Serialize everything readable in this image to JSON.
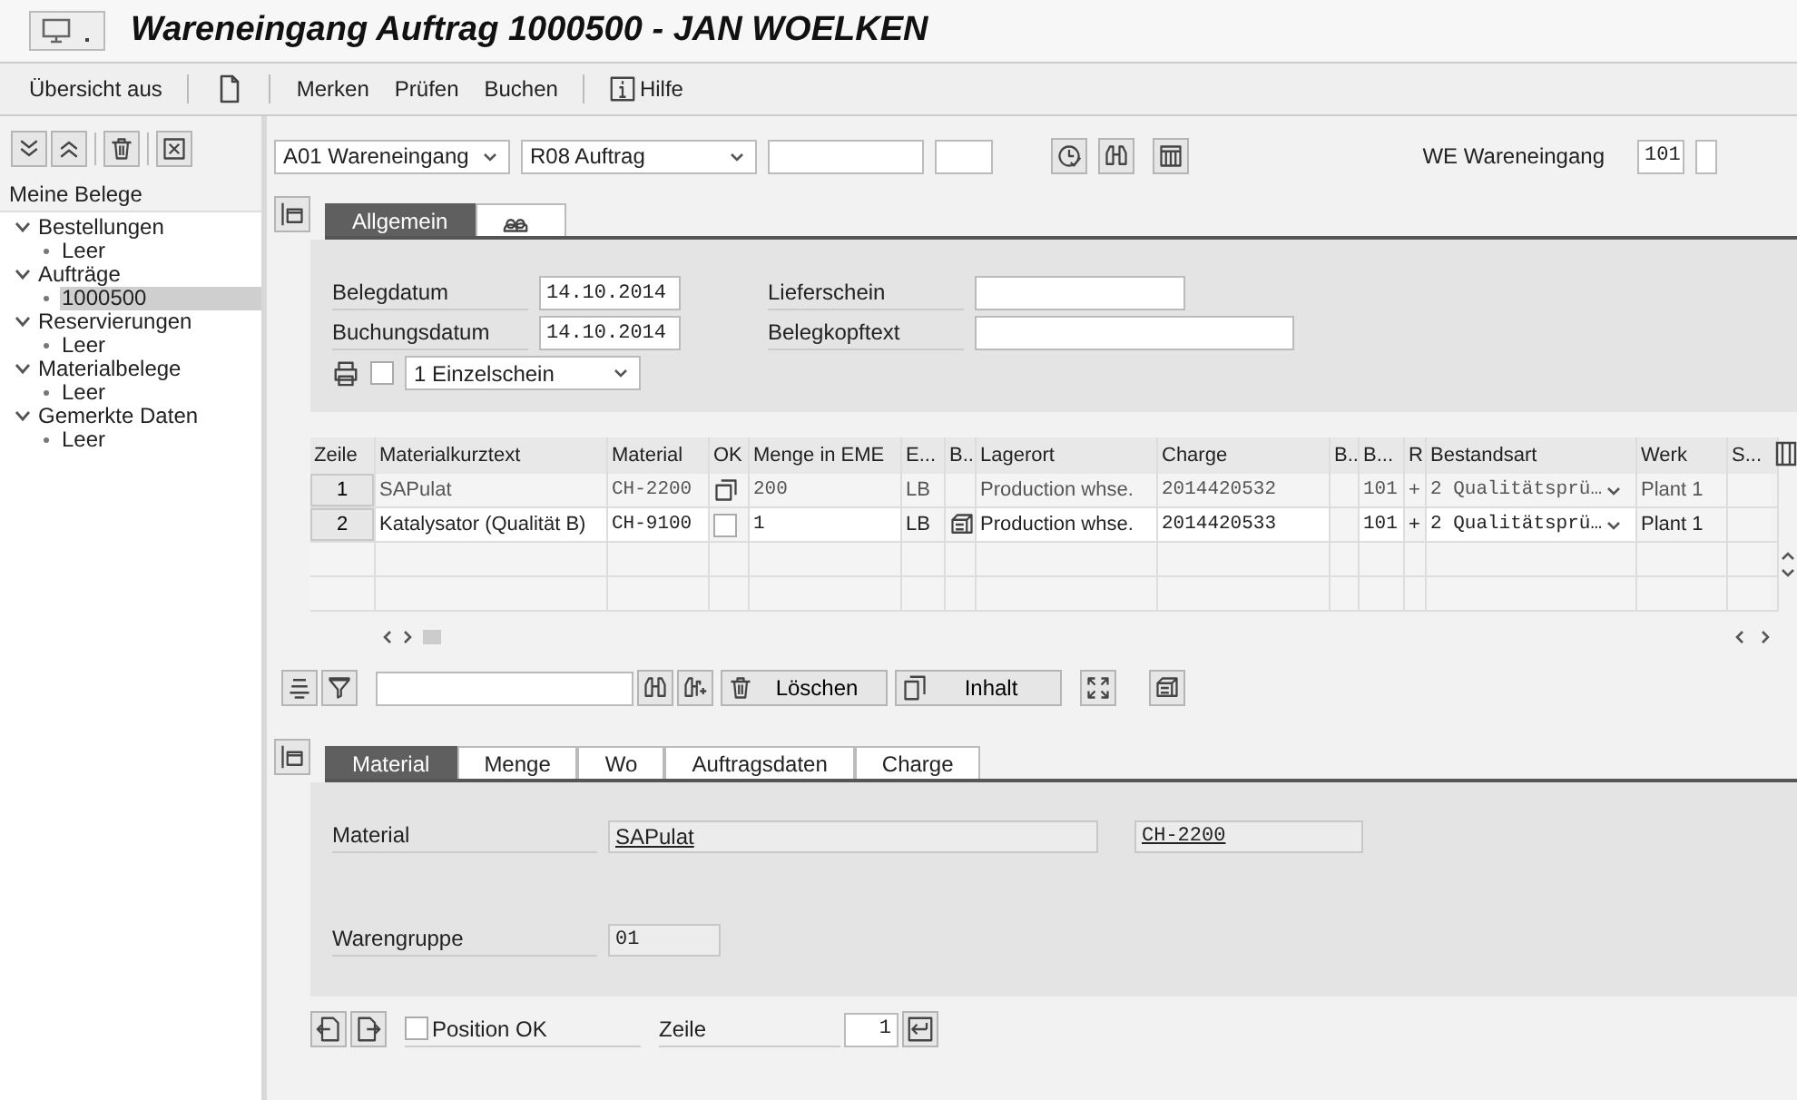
{
  "window": {
    "title": "Wareneingang Auftrag 1000500 - JAN WOELKEN"
  },
  "toolbar": {
    "groups": [
      [
        {
          "kind": "text",
          "label": "Übersicht aus"
        }
      ],
      [
        {
          "kind": "document"
        }
      ],
      [
        {
          "kind": "text",
          "label": "Merken"
        },
        {
          "kind": "text",
          "label": "Prüfen"
        },
        {
          "kind": "text",
          "label": "Buchen"
        }
      ],
      [
        {
          "kind": "help",
          "label": "Hilfe"
        }
      ]
    ]
  },
  "sidebar": {
    "title": "Meine Belege",
    "tree": [
      {
        "label": "Bestellungen",
        "expanded": true,
        "selected": false,
        "children": [
          {
            "label": "Leer",
            "selected": false
          }
        ]
      },
      {
        "label": "Aufträge",
        "expanded": true,
        "selected": false,
        "children": [
          {
            "label": "1000500",
            "selected": true
          }
        ]
      },
      {
        "label": "Reservierungen",
        "expanded": true,
        "selected": false,
        "children": [
          {
            "label": "Leer",
            "selected": false
          }
        ]
      },
      {
        "label": "Materialbelege",
        "expanded": true,
        "selected": false,
        "children": [
          {
            "label": "Leer",
            "selected": false
          }
        ]
      },
      {
        "label": "Gemerkte Daten",
        "expanded": true,
        "selected": false,
        "children": [
          {
            "label": "Leer",
            "selected": false
          }
        ]
      }
    ]
  },
  "selection": {
    "action": "A01 Wareneingang",
    "reference": "R08 Auftrag",
    "movement_label": "WE Wareneingang",
    "movement_type": "101"
  },
  "header": {
    "tabs": [
      {
        "kind": "text",
        "label": "Allgemein",
        "selected": true
      },
      {
        "kind": "partner",
        "selected": false
      }
    ],
    "fields_left": [
      {
        "label": "Belegdatum",
        "value": "14.10.2014"
      },
      {
        "label": "Buchungsdatum",
        "value": "14.10.2014"
      }
    ],
    "fields_right": [
      {
        "label": "Lieferschein"
      },
      {
        "label": "Belegkopftext"
      }
    ],
    "print": {
      "checked": false,
      "option": "1 Einzelschein"
    }
  },
  "items": {
    "columns": [
      "Zeile",
      "Materialkurztext",
      "Material",
      "OK",
      "Menge in EME",
      "E...",
      "B..",
      "Lagerort",
      "Charge",
      "B..",
      "B...",
      "R",
      "Bestandsart",
      "Werk",
      "S..."
    ],
    "rows": [
      {
        "line": "1",
        "text": "SAPulat",
        "material": "CH-2200",
        "ok": {
          "kind": "copy"
        },
        "quantity": "200",
        "unit": "LB",
        "storage_icon": false,
        "location": "Production whse.",
        "batch": "2014420532",
        "movement": "101",
        "indicator": "+",
        "stock_type": "2 Qualitätsprü…",
        "plant": "Plant 1",
        "editable": false
      },
      {
        "line": "2",
        "text": "Katalysator (Qualität B)",
        "material": "CH-9100",
        "ok": {
          "kind": "checkbox",
          "checked": false
        },
        "quantity": "1",
        "unit": "LB",
        "storage_icon": true,
        "location": "Production whse.",
        "batch": "2014420533",
        "movement": "101",
        "indicator": "+",
        "stock_type": "2 Qualitätsprü…",
        "plant": "Plant 1",
        "editable": true
      }
    ],
    "buttons": [
      {
        "kind": "delete",
        "label": "Löschen"
      },
      {
        "kind": "content",
        "label": "Inhalt"
      }
    ]
  },
  "detail": {
    "tabs": [
      {
        "label": "Material",
        "selected": true
      },
      {
        "label": "Menge",
        "selected": false
      },
      {
        "label": "Wo",
        "selected": false
      },
      {
        "label": "Auftragsdaten",
        "selected": false
      },
      {
        "label": "Charge",
        "selected": false
      }
    ],
    "material_label": "Material",
    "material_text": "SAPulat",
    "material_number": "CH-2200",
    "group_label": "Warengruppe",
    "group_value": "01"
  },
  "footer": {
    "position_ok_label": "Position OK",
    "position_ok_checked": false,
    "line_label": "Zeile",
    "line_value": "1"
  }
}
